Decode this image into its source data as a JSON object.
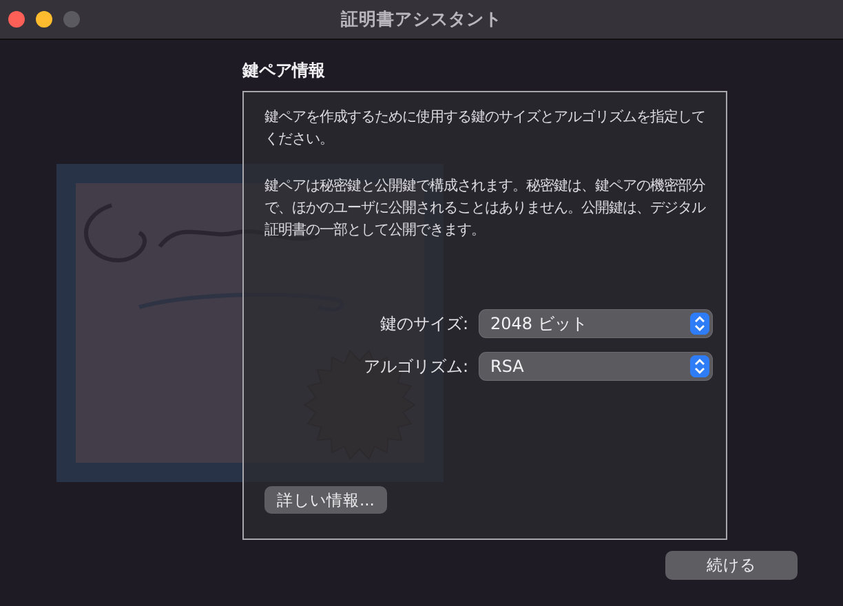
{
  "window": {
    "title": "証明書アシスタント",
    "controls": [
      {
        "kind": "close"
      },
      {
        "kind": "minimize"
      },
      {
        "kind": "zoom"
      }
    ]
  },
  "section": {
    "title": "鍵ペア情報",
    "paragraphs": [
      "鍵ペアを作成するために使用する鍵のサイズとアルゴリズムを指定してください。",
      "鍵ペアは秘密鍵と公開鍵で構成されます。秘密鍵は、鍵ペアの機密部分で、ほかのユーザに公開されることはありません。公開鍵は、デジタル証明書の一部として公開できます。"
    ],
    "fields": [
      {
        "label": "鍵のサイズ:",
        "value": "2048 ビット"
      },
      {
        "label": "アルゴリズム:",
        "value": "RSA"
      }
    ],
    "more_button": "詳しい情報..."
  },
  "buttons": [
    {
      "label": "続ける"
    }
  ]
}
